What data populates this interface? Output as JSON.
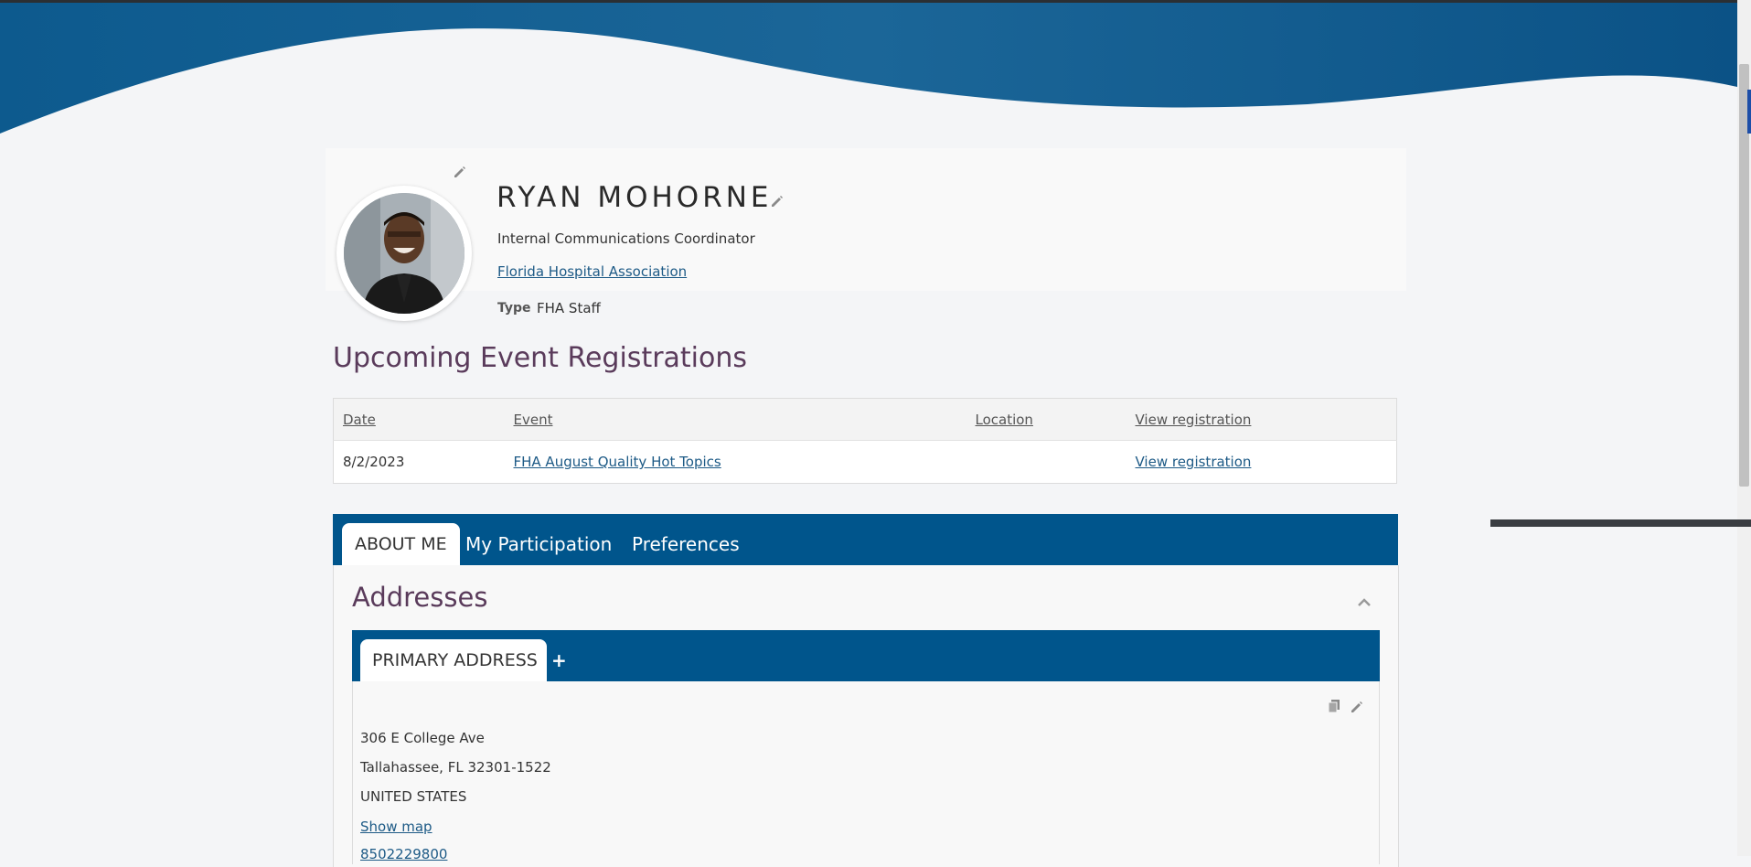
{
  "profile": {
    "name": "RYAN MOHORNE",
    "job_title": "Internal Communications Coordinator",
    "organization": "Florida Hospital Association",
    "type_label": "Type",
    "type_value": "FHA Staff"
  },
  "registrations": {
    "title": "Upcoming Event Registrations",
    "columns": [
      "Date",
      "Event",
      "Location",
      "View registration"
    ],
    "rows": [
      {
        "date": "8/2/2023",
        "event": "FHA August Quality Hot Topics",
        "location": "",
        "view": "View registration"
      }
    ]
  },
  "tabs": [
    {
      "label": "ABOUT ME",
      "active": true
    },
    {
      "label": "My Participation",
      "active": false
    },
    {
      "label": "Preferences",
      "active": false
    }
  ],
  "addresses": {
    "title": "Addresses",
    "tab_active": "PRIMARY ADDRESS",
    "tab_add": "+",
    "lines": [
      "306 E College Ave",
      "Tallahassee, FL 32301-1522",
      "UNITED STATES"
    ],
    "map_link": "Show map",
    "phone": "8502229800"
  },
  "colors": {
    "brand_blue": "#00558c",
    "heading_purple": "#5a3b5b",
    "link_blue": "#1d5a86"
  },
  "icons": [
    "pencil-icon",
    "chevron-up-icon",
    "copy-icon"
  ]
}
